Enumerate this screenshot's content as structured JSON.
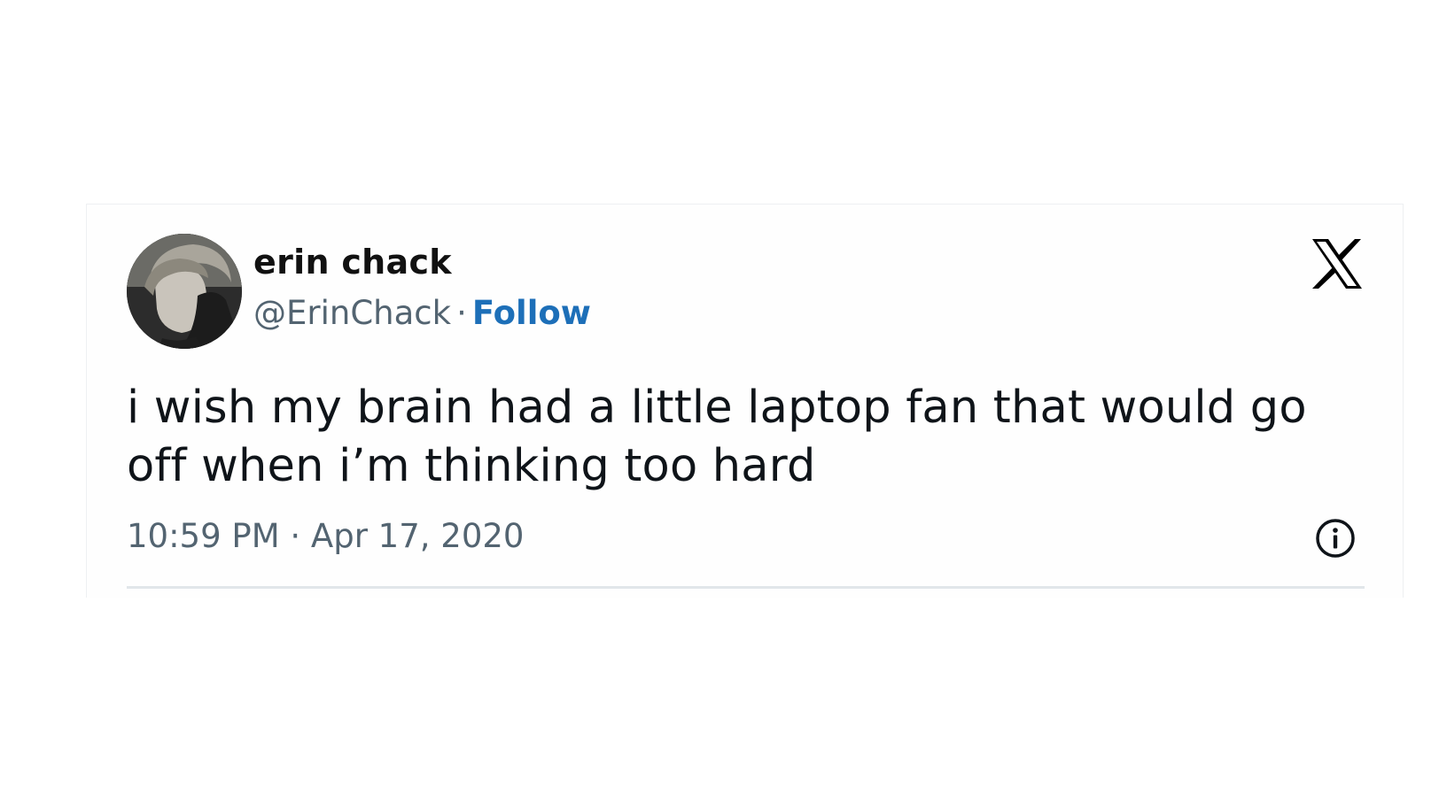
{
  "tweet": {
    "author": {
      "display_name": "erin chack",
      "handle": "@ErinChack",
      "separator": "·",
      "follow_label": "Follow"
    },
    "text": "i wish my brain had a little laptop fan that would go off when i’m thinking too hard",
    "timestamp": "10:59 PM · Apr 17, 2020",
    "icons": {
      "brand": "x-logo-icon",
      "info": "info-icon"
    }
  },
  "colors": {
    "follow_link": "#1d6fb8",
    "secondary_text": "#536471",
    "primary_text": "#0f1419",
    "divider": "#e1e6ea"
  }
}
